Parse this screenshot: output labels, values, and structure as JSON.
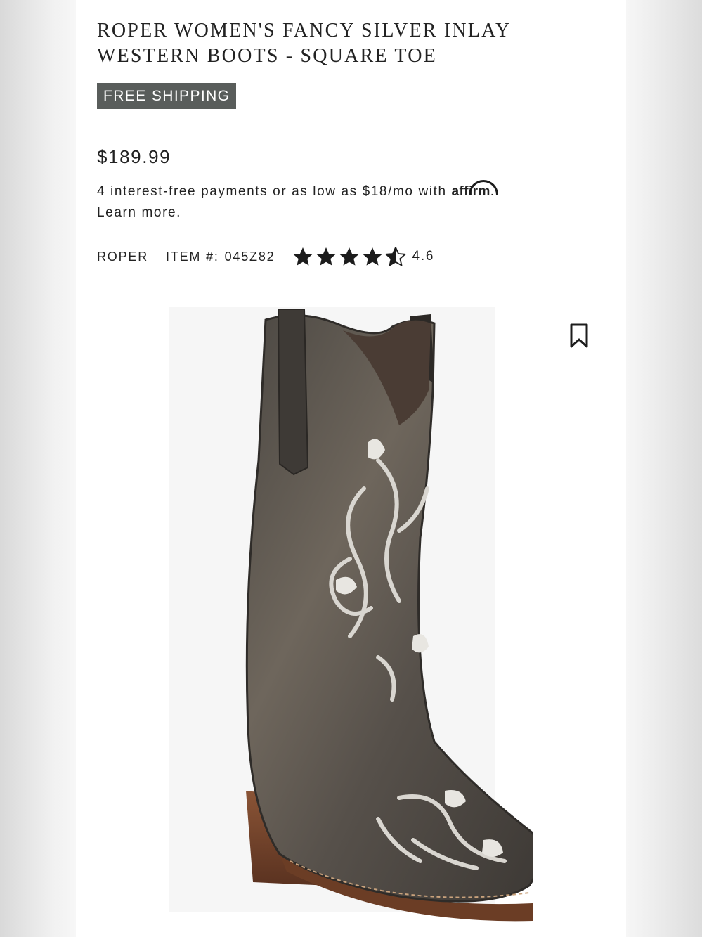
{
  "product": {
    "title": "ROPER WOMEN'S FANCY SILVER INLAY WESTERN BOOTS - SQUARE TOE",
    "badge": "FREE SHIPPING",
    "price": "$189.99",
    "financing": {
      "text": "4 interest-free payments or as low as $18/mo with",
      "provider_logo": "affirm",
      "period": ".",
      "learn_more": "Learn more."
    },
    "brand": "ROPER",
    "item_label": "ITEM #:",
    "item_number": "045Z82",
    "rating": "4.6",
    "rating_value": 4.6,
    "rating_max": 5
  },
  "icons": {
    "bookmark": "bookmark-icon",
    "star": "star-icon"
  },
  "colors": {
    "badge_bg": "#595d5b",
    "text": "#222222",
    "page_bg": "#ffffff"
  }
}
